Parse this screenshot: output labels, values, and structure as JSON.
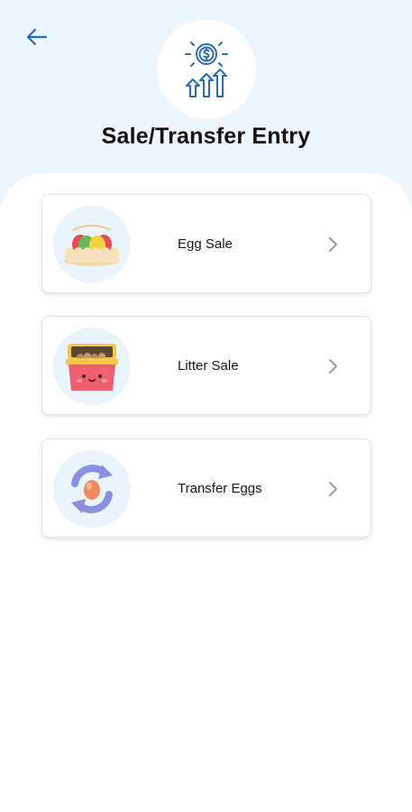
{
  "header": {
    "title": "Sale/Transfer Entry",
    "back_icon": "arrow-left-icon",
    "hero_icon": "sales-growth-icon"
  },
  "menu": {
    "items": [
      {
        "label": "Egg Sale",
        "icon": "egg-tray-icon"
      },
      {
        "label": "Litter Sale",
        "icon": "litter-box-icon"
      },
      {
        "label": "Transfer Eggs",
        "icon": "egg-transfer-icon"
      }
    ]
  },
  "colors": {
    "header_background": "#eef6fd",
    "accent_blue": "#2a6bb5",
    "chevron_gray": "#9a9a9a"
  }
}
